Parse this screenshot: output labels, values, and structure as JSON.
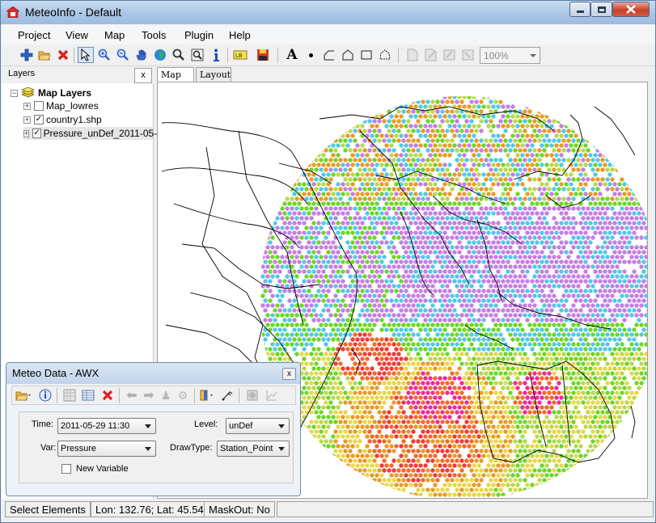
{
  "window": {
    "title": "MeteoInfo - Default"
  },
  "menu": [
    "Project",
    "View",
    "Map",
    "Tools",
    "Plugin",
    "Help"
  ],
  "toolbar": {
    "zoom_value": "100%"
  },
  "layers_panel": {
    "title": "Layers",
    "close": "x",
    "root": "Map Layers",
    "items": [
      {
        "name": "Map_lowres",
        "checked": false
      },
      {
        "name": "country1.shp",
        "checked": true
      },
      {
        "name": "Pressure_unDef_2011-05-",
        "checked": true
      }
    ]
  },
  "tabs": {
    "map": "Map",
    "layout": "Layout"
  },
  "status": {
    "mode": "Select Elements",
    "coords": "Lon: 132.76; Lat: 45.54",
    "maskout": "MaskOut: No"
  },
  "meteo_dialog": {
    "title": "Meteo Data - AWX",
    "close": "x",
    "time_label": "Time:",
    "time_value": "2011-05-29 11:30",
    "level_label": "Level:",
    "level_value": "unDef",
    "var_label": "Var:",
    "var_value": "Pressure",
    "drawtype_label": "DrawType:",
    "drawtype_value": "Station_Point",
    "new_variable_label": "New Variable"
  },
  "legend_colors": {
    "purple": "#c57fe2",
    "cyan": "#54c8e6",
    "lime": "#6ed628",
    "yellow_green": "#b8d84e",
    "yellow": "#e6d84a",
    "orange": "#e89b28",
    "dark_orange": "#f06a2c",
    "red": "#f03a3a",
    "magenta": "#f02a9a"
  }
}
